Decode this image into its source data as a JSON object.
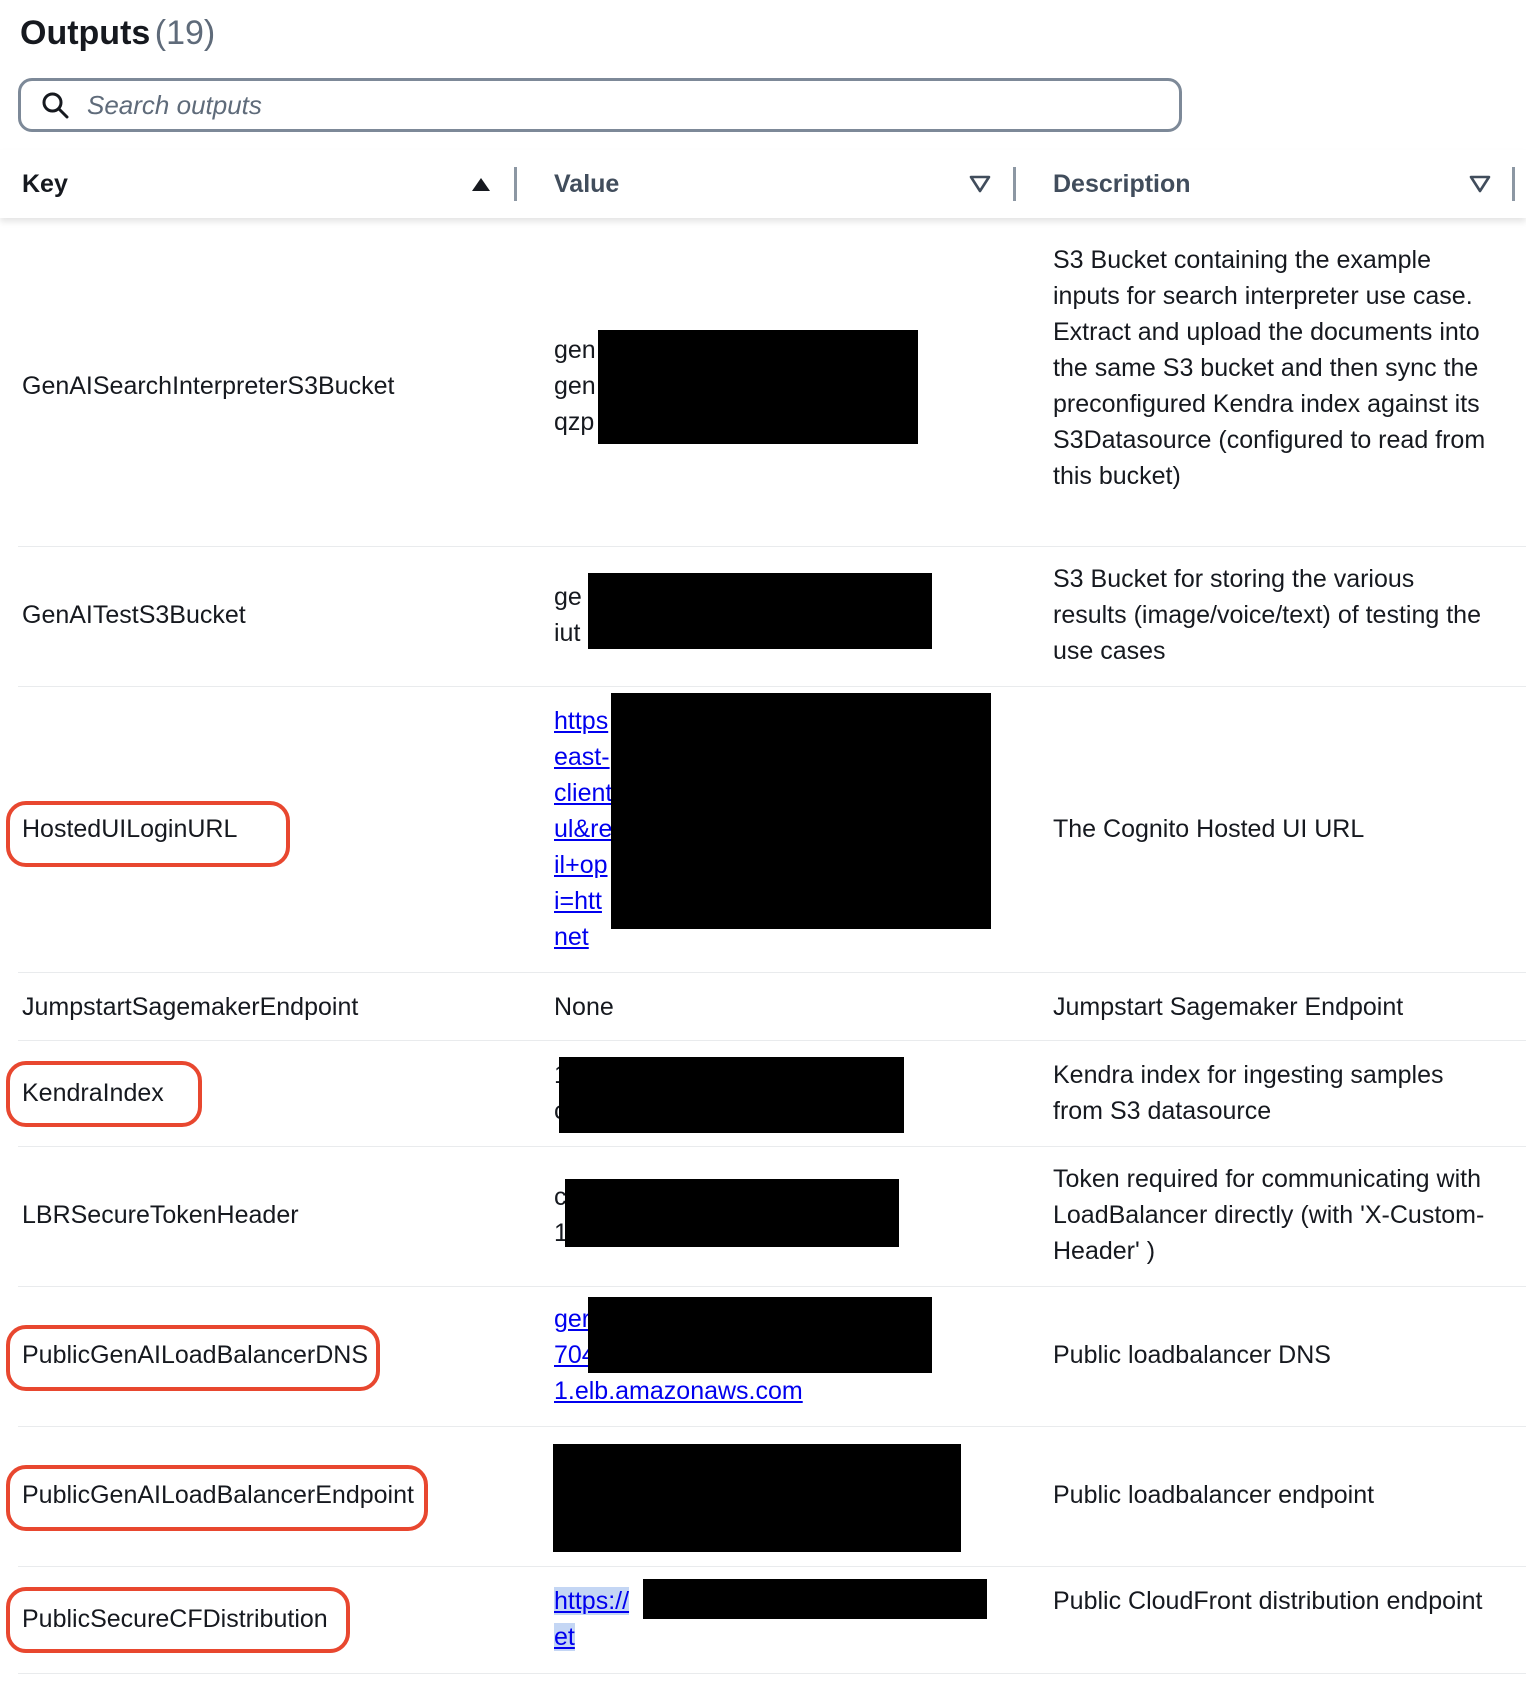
{
  "header": {
    "title": "Outputs",
    "count": "(19)"
  },
  "search": {
    "placeholder": "Search outputs",
    "value": ""
  },
  "columns": {
    "key": "Key",
    "value": "Value",
    "description": "Description"
  },
  "colors": {
    "highlight": "#e8472f",
    "link": "#0000ee",
    "redaction": "#000000"
  },
  "rows": [
    {
      "key": "GenAISearchInterpreterS3Bucket",
      "value_lines": [
        "gen",
        "gen",
        "qzp"
      ],
      "description": "S3 Bucket containing the example inputs for search interpreter use case. Extract and upload the documents into the same S3 bucket and then sync the preconfigured Kendra index against its S3Datasource (configured to read from this bucket)"
    },
    {
      "key": "GenAITestS3Bucket",
      "value_lines": [
        "ge",
        "iut"
      ],
      "description": "S3 Bucket for storing the various results (image/voice/text) of testing the use cases"
    },
    {
      "key": "HostedUILoginURL",
      "value_lines": [
        "https",
        "east-",
        "client",
        "ul&re",
        "il+op",
        "i=htt",
        "net"
      ],
      "description": "The Cognito Hosted UI URL"
    },
    {
      "key": "JumpstartSagemakerEndpoint",
      "value_lines": [
        "None"
      ],
      "description": "Jumpstart Sagemaker Endpoint"
    },
    {
      "key": "KendraIndex",
      "value_lines": [
        "1",
        "c"
      ],
      "description": "Kendra index for ingesting samples from S3 datasource"
    },
    {
      "key": "LBRSecureTokenHeader",
      "value_lines": [
        "c",
        "1"
      ],
      "description": "Token required for communicating with LoadBalancer directly (with 'X-Custom-Header' )"
    },
    {
      "key": "PublicGenAILoadBalancerDNS",
      "value_lines": [
        "ger",
        "704",
        "1.elb.amazonaws.com"
      ],
      "description": "Public loadbalancer DNS"
    },
    {
      "key": "PublicGenAILoadBalancerEndpoint",
      "value_lines": [],
      "description": "Public loadbalancer endpoint"
    },
    {
      "key": "PublicSecureCFDistribution",
      "value_lines": [
        "https://",
        "et"
      ],
      "description": "Public CloudFront distribution endpoint"
    }
  ]
}
